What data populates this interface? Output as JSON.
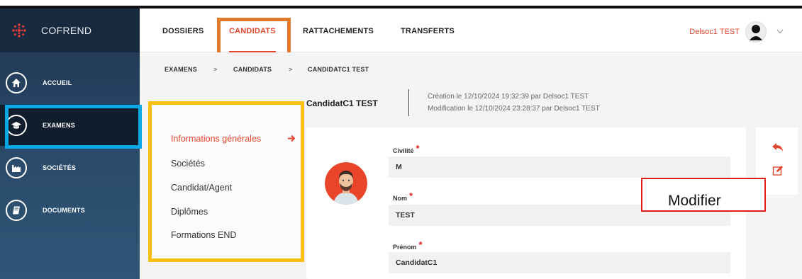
{
  "app": {
    "name": "COFREND"
  },
  "header": {
    "tabs": [
      {
        "label": "DOSSIERS"
      },
      {
        "label": "CANDIDATS"
      },
      {
        "label": "RATTACHEMENTS"
      },
      {
        "label": "TRANSFERTS"
      }
    ],
    "active_tab": "CANDIDATS",
    "user_name": "Delsoc1 TEST",
    "accent": "#e4462f"
  },
  "sidebar": {
    "items": [
      {
        "label": "ACCUEIL",
        "icon": "home-icon"
      },
      {
        "label": "EXAMENS",
        "icon": "graduation-cap-icon"
      },
      {
        "label": "SOCIÉTÉS",
        "icon": "factory-icon"
      },
      {
        "label": "DOCUMENTS",
        "icon": "book-icon"
      }
    ],
    "active_item": "EXAMENS"
  },
  "breadcrumb": {
    "items": [
      "EXAMENS",
      "CANDIDATS",
      "CANDIDATC1 TEST"
    ],
    "separator": ">"
  },
  "candidate": {
    "name": "CandidatC1 TEST",
    "created": "Création le 12/10/2024 19:32:39 par Delsoc1 TEST",
    "modified": "Modification le 12/10/2024 23:28:37 par Delsoc1 TEST"
  },
  "menu": {
    "items": [
      {
        "label": "Informations générales"
      },
      {
        "label": "Sociétés"
      },
      {
        "label": "Candidat/Agent"
      },
      {
        "label": "Diplômes"
      },
      {
        "label": "Formations END"
      }
    ],
    "active": "Informations générales"
  },
  "form": {
    "civilite": {
      "label": "Civilité",
      "value": "M"
    },
    "nom": {
      "label": "Nom",
      "value": "TEST"
    },
    "prenom": {
      "label": "Prénom",
      "value": "CandidatC1"
    },
    "required_mark": "*"
  },
  "actions": {
    "back_icon": "undo-icon",
    "edit_icon": "edit-icon"
  },
  "callout": {
    "text": "Modifier"
  },
  "highlights": {
    "orange": "#e5792b",
    "blue": "#0aa7e6",
    "yellow": "#fbbf14",
    "red": "#e21c1c"
  }
}
